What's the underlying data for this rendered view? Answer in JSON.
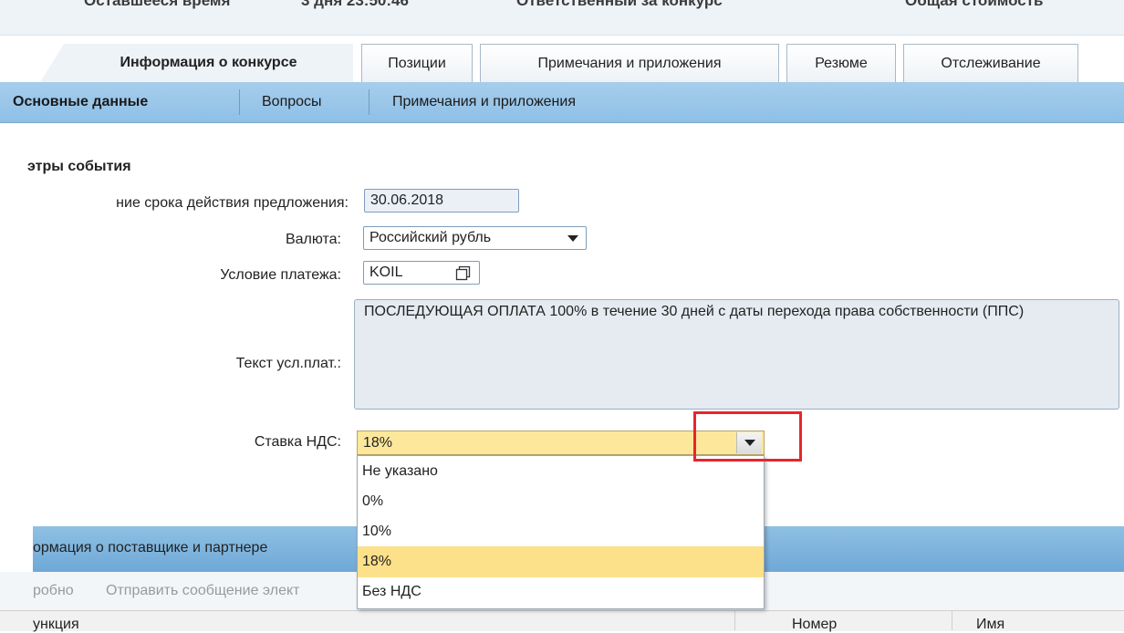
{
  "top_bar": {
    "cut_texts": [
      "Оставшееся время",
      "3 дня 23:50:46",
      "Ответственный за конкурс",
      "Общая стоимость"
    ]
  },
  "tabs": [
    {
      "label": "Информация о конкурсе",
      "active": true
    },
    {
      "label": "Позиции",
      "active": false
    },
    {
      "label": "Примечания и приложения",
      "active": false
    },
    {
      "label": "Резюме",
      "active": false
    },
    {
      "label": "Отслеживание",
      "active": false
    }
  ],
  "subnav": [
    {
      "label": "Основные данные",
      "active": true
    },
    {
      "label": "Вопросы",
      "active": false
    },
    {
      "label": "Примечания и приложения",
      "active": false
    }
  ],
  "section": {
    "title": "этры события"
  },
  "fields": {
    "validity_label": "ние срока действия предложения:",
    "validity_value": "30.06.2018",
    "currency_label": "Валюта:",
    "currency_value": "Российский рубль",
    "payment_label": "Условие платежа:",
    "payment_value": "KOIL",
    "payment_text_label": "Текст усл.плат.:",
    "payment_text_value": "ПОСЛЕДУЮЩАЯ ОПЛАТА 100% в течение 30 дней с даты перехода права собственности (ППС)",
    "vat_label": "Ставка НДС:",
    "vat_value": "18%"
  },
  "vat_options": [
    "Не указано",
    "0%",
    "10%",
    "18%",
    "Без НДС"
  ],
  "vat_selected_index": 3,
  "supplier": {
    "section_label": "ормация о поставщике и партнере",
    "toolbar_detail": "робно",
    "toolbar_send": "Отправить сообщение элект",
    "col_function": "ункция",
    "col_number": "Номер",
    "col_name": "Имя"
  },
  "colors": {
    "highlight": "#e8262a",
    "selected": "#fde08a",
    "bar": "#8ec0e6"
  }
}
